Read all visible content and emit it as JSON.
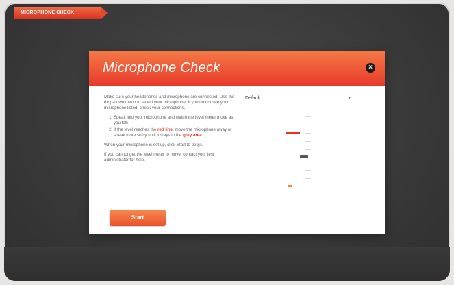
{
  "top_tab": {
    "label": "MICROPHONE CHECK"
  },
  "modal": {
    "title": "Microphone Check",
    "close_label": "×",
    "instructions": {
      "intro": "Make sure your headphones and microphone are connected. Use the drop-down menu to select your microphone. If you do not see your microphone listed, check your connections.",
      "step1": "Speak into your microphone and watch the level meter move as you talk.",
      "step2": "If the level reaches the red line, move the microphone away or speak more softly until it stays in the grey area.",
      "note1": "When your microphone is set up, click Start to begin.",
      "note2": "If you cannot get the level meter to move, contact your test administrator for help."
    },
    "start_label": "Start",
    "select_value": "Default"
  },
  "meter": {
    "level_fraction": 0.72
  }
}
